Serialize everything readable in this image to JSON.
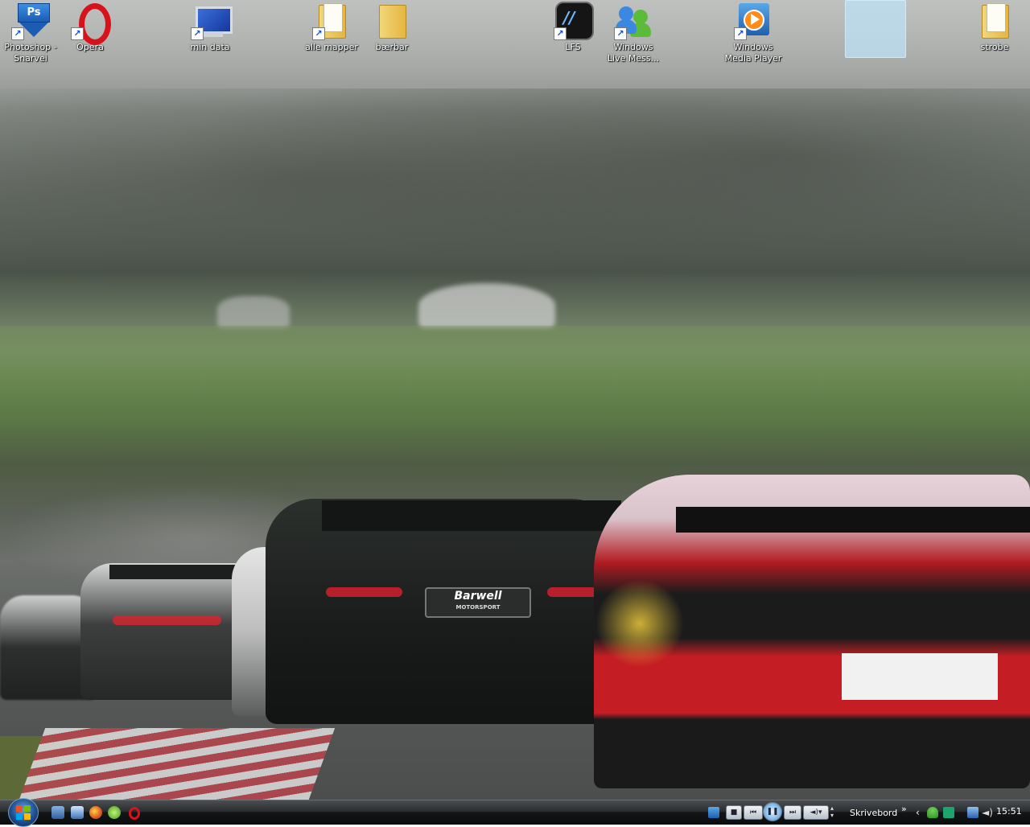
{
  "desktop": {
    "icons": [
      {
        "label": "Photoshop -\nSnarvei",
        "icon": "photoshop-shortcut-icon"
      },
      {
        "label": "Opera",
        "icon": "opera-icon"
      },
      {
        "label": "min data",
        "icon": "computer-icon"
      },
      {
        "label": "alle mapper",
        "icon": "folder-icon"
      },
      {
        "label": "bærbar",
        "icon": "folder-icon"
      },
      {
        "label": "LFS",
        "icon": "lfs-icon"
      },
      {
        "label": "Windows\nLive Mess...",
        "icon": "messenger-icon"
      },
      {
        "label": "Windows\nMedia Player",
        "icon": "media-player-icon"
      },
      {
        "label": "strobe",
        "icon": "folder-icon"
      }
    ],
    "wallpaper": {
      "car_text": "Barwell",
      "car_subtext": "MOTORSPORT"
    }
  },
  "photoshop_badge": "Ps",
  "taskbar": {
    "toolbar_label": "Skrivebord",
    "chevron": "»",
    "clock": "15:51",
    "accent": "#1f4f8f"
  }
}
